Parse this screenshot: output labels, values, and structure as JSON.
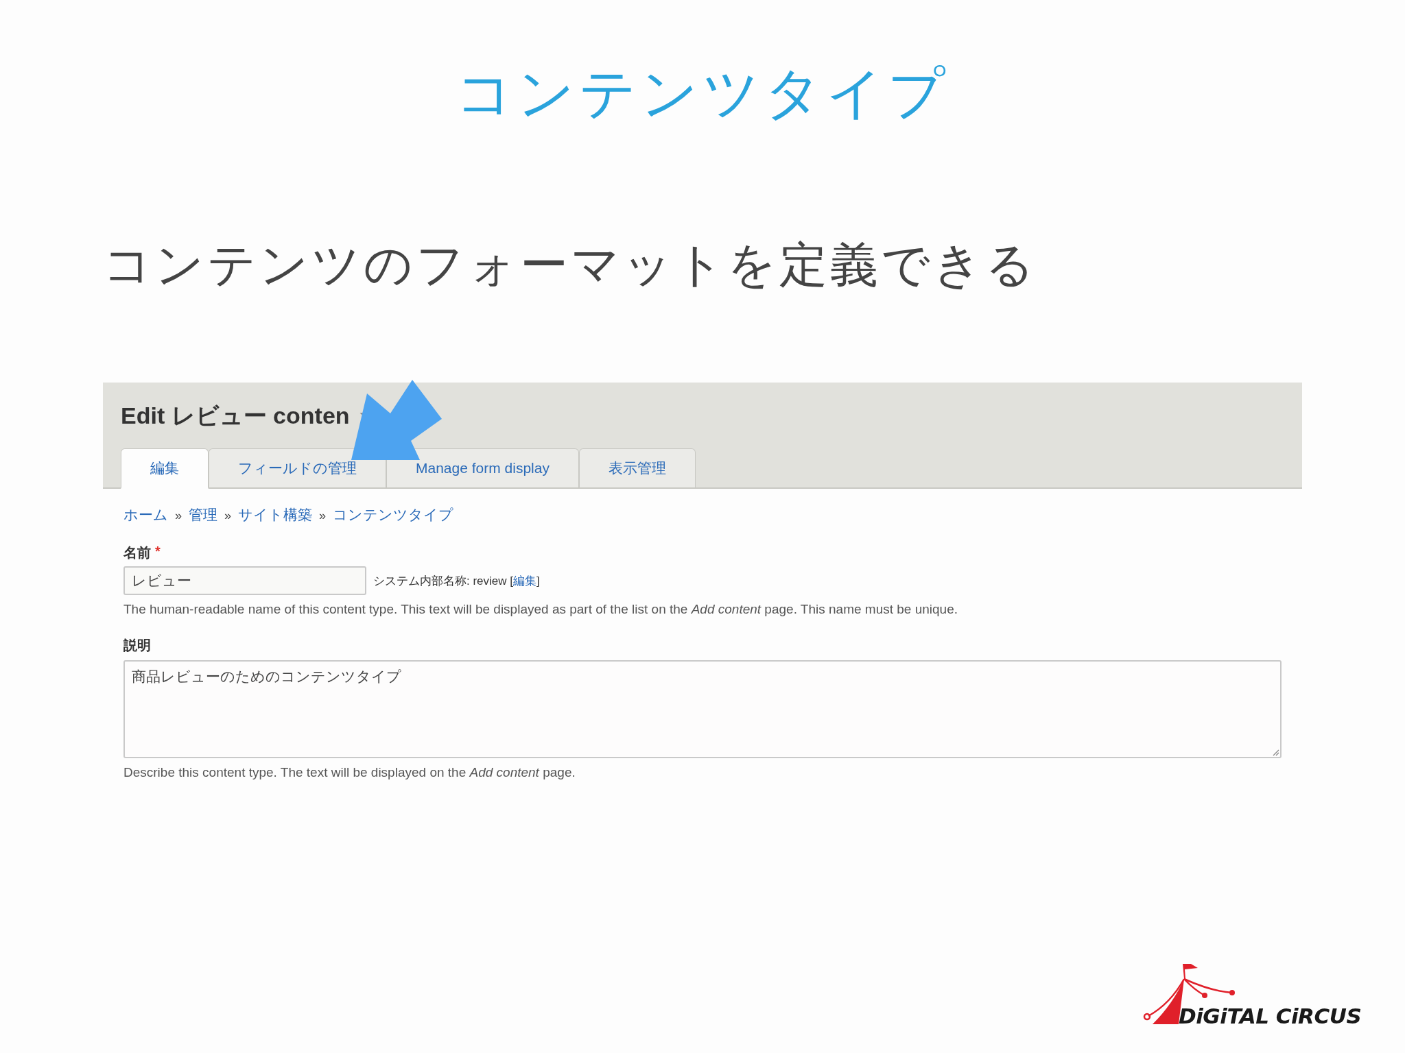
{
  "slide": {
    "title": "コンテンツタイプ",
    "subtitle": "コンテンツのフォーマットを定義できる"
  },
  "screenshot": {
    "page_title": "Edit レビュー conten",
    "tabs": [
      {
        "label": "編集",
        "selected": true
      },
      {
        "label": "フィールドの管理",
        "selected": false
      },
      {
        "label": "Manage form display",
        "selected": false
      },
      {
        "label": "表示管理",
        "selected": false
      }
    ],
    "breadcrumb": [
      {
        "kind": "link",
        "text": "ホーム"
      },
      {
        "kind": "separator",
        "text": "»"
      },
      {
        "kind": "link",
        "text": "管理"
      },
      {
        "kind": "separator",
        "text": "»"
      },
      {
        "kind": "link",
        "text": "サイト構築"
      },
      {
        "kind": "separator",
        "text": "»"
      },
      {
        "kind": "link",
        "text": "コンテンツタイプ"
      }
    ],
    "name_field": {
      "label": "名前",
      "required_mark": "*",
      "value": "レビュー",
      "machine_name": "システム内部名称: review",
      "brackets": [
        "[",
        "]"
      ],
      "edit_link": "編集",
      "help": "The human-readable name of this content type. This text will be displayed as part of the list on the *Add content* page. This name must be unique."
    },
    "description_field": {
      "label": "説明",
      "value": "商品レビューのためのコンテンツタイプ",
      "help": "Describe this content type. The text will be displayed on the *Add content* page."
    }
  },
  "logo": {
    "text": "DiGiTAL CiRCUS"
  }
}
